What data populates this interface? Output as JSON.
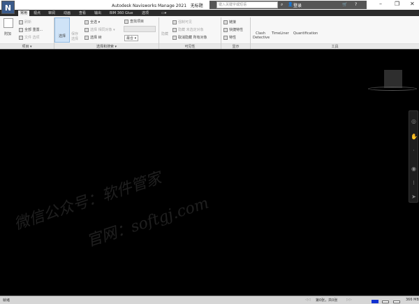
{
  "title": "Autodesk Navisworks Manage 2021",
  "doc": "无标题",
  "app_button": "N",
  "search_placeholder": "键入关键字或短语",
  "signin": "登录",
  "tabs": [
    "常用",
    "视点",
    "审阅",
    "动画",
    "查看",
    "输出",
    "BIM 360 Glue",
    "选项"
  ],
  "ribbon": {
    "append": "附加",
    "refresh": "刷新",
    "reset_all": "全部 重置...",
    "file_options": "文件 选项",
    "select": "选择",
    "save_select": "保存 选择",
    "select_all": "全选",
    "select_same": "选择 相同对象",
    "select_tree": "选择 树",
    "find_items": "查找项目",
    "quick_find": "",
    "merge": "最合",
    "hide": "隐藏",
    "require": "强制可见",
    "hide_unselected": "隐藏 未选定对象",
    "unhide_all": "取消隐藏 所有对象",
    "links": "链接",
    "quick_props": "快捷特性",
    "properties": "特性",
    "clash": "Clash Detective",
    "timeliner": "TimeLiner",
    "quantification": "Quantification"
  },
  "panels": [
    "项目 ▾",
    "选择和搜索 ▾",
    "可见性",
    "显示",
    "工具"
  ],
  "watermark": [
    "微信公众号：软件管家",
    "官网：softgj.com"
  ],
  "status": {
    "ready": "就绪",
    "sheet": "第0张，共0张",
    "memory": "366 MB"
  },
  "colors": {
    "viewport": "#000000",
    "ribbon": "#f7f7f7",
    "tabbar": "#2b2b2b"
  }
}
